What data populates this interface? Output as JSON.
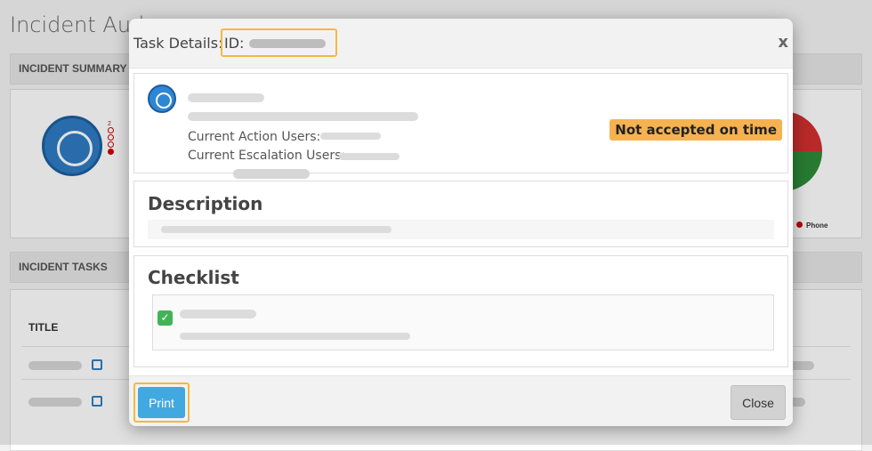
{
  "background": {
    "page_title": "Incident Aud",
    "summary_bar": "INCIDENT SUMMARY",
    "tasks_bar": "INCIDENT TASKS",
    "table_header": "TITLE",
    "legend_label": "Phone",
    "counter_labels": [
      "2"
    ]
  },
  "modal": {
    "title": "Task Details:",
    "id_label": "ID:",
    "close_x": "x",
    "current_action_users_label": "Current Action Users:",
    "current_escalation_users_label": "Current Escalation Users:",
    "status_badge": "Not accepted on time",
    "description_heading": "Description",
    "checklist_heading": "Checklist",
    "checkbox_mark": "✓",
    "print_label": "Print",
    "close_label": "Close"
  },
  "colors": {
    "accent": "#42a8e0",
    "badge": "#f6b250",
    "highlight": "#f5b841",
    "checkbox": "#42b356"
  }
}
